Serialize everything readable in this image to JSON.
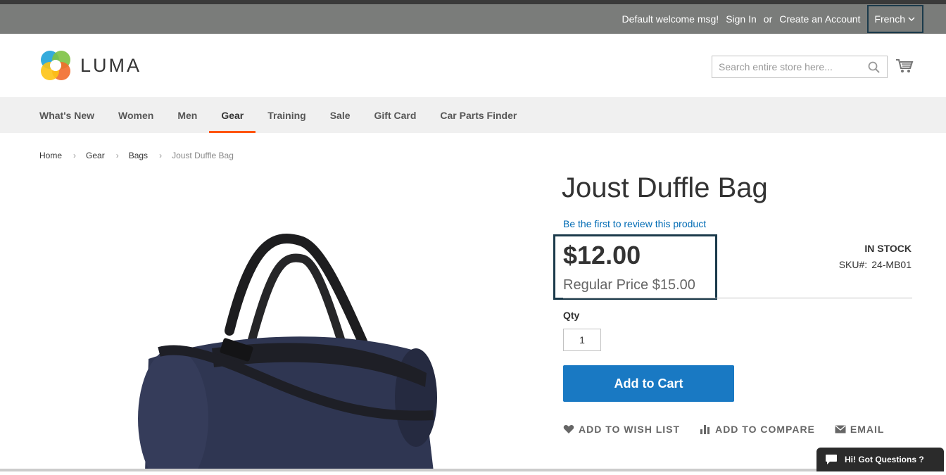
{
  "header": {
    "welcome": "Default welcome msg!",
    "sign_in": "Sign In",
    "or": "or",
    "create_account": "Create an Account",
    "language": "French"
  },
  "logo": {
    "text": "LUMA"
  },
  "search": {
    "placeholder": "Search entire store here...",
    "value": ""
  },
  "nav": {
    "items": [
      "What's New",
      "Women",
      "Men",
      "Gear",
      "Training",
      "Sale",
      "Gift Card",
      "Car Parts Finder"
    ],
    "active": "Gear"
  },
  "breadcrumbs": [
    "Home",
    "Gear",
    "Bags",
    "Joust Duffle Bag"
  ],
  "product": {
    "name": "Joust Duffle Bag",
    "review_link": "Be the first to review this product",
    "final_price": "$12.00",
    "regular_price": "Regular Price $15.00",
    "stock": "IN STOCK",
    "sku_label": "SKU#:",
    "sku": "24-MB01",
    "qty_label": "Qty",
    "qty": "1",
    "add_to_cart": "Add to Cart",
    "wishlist": "Add to Wish List",
    "compare": "Add to Compare",
    "email": "Email"
  },
  "chat": {
    "label": "Hi! Got Questions ?"
  },
  "colors": {
    "accent": "#1979c3",
    "nav_active": "#ff5501",
    "link": "#006bb4",
    "highlight": "#1b3a4b"
  }
}
